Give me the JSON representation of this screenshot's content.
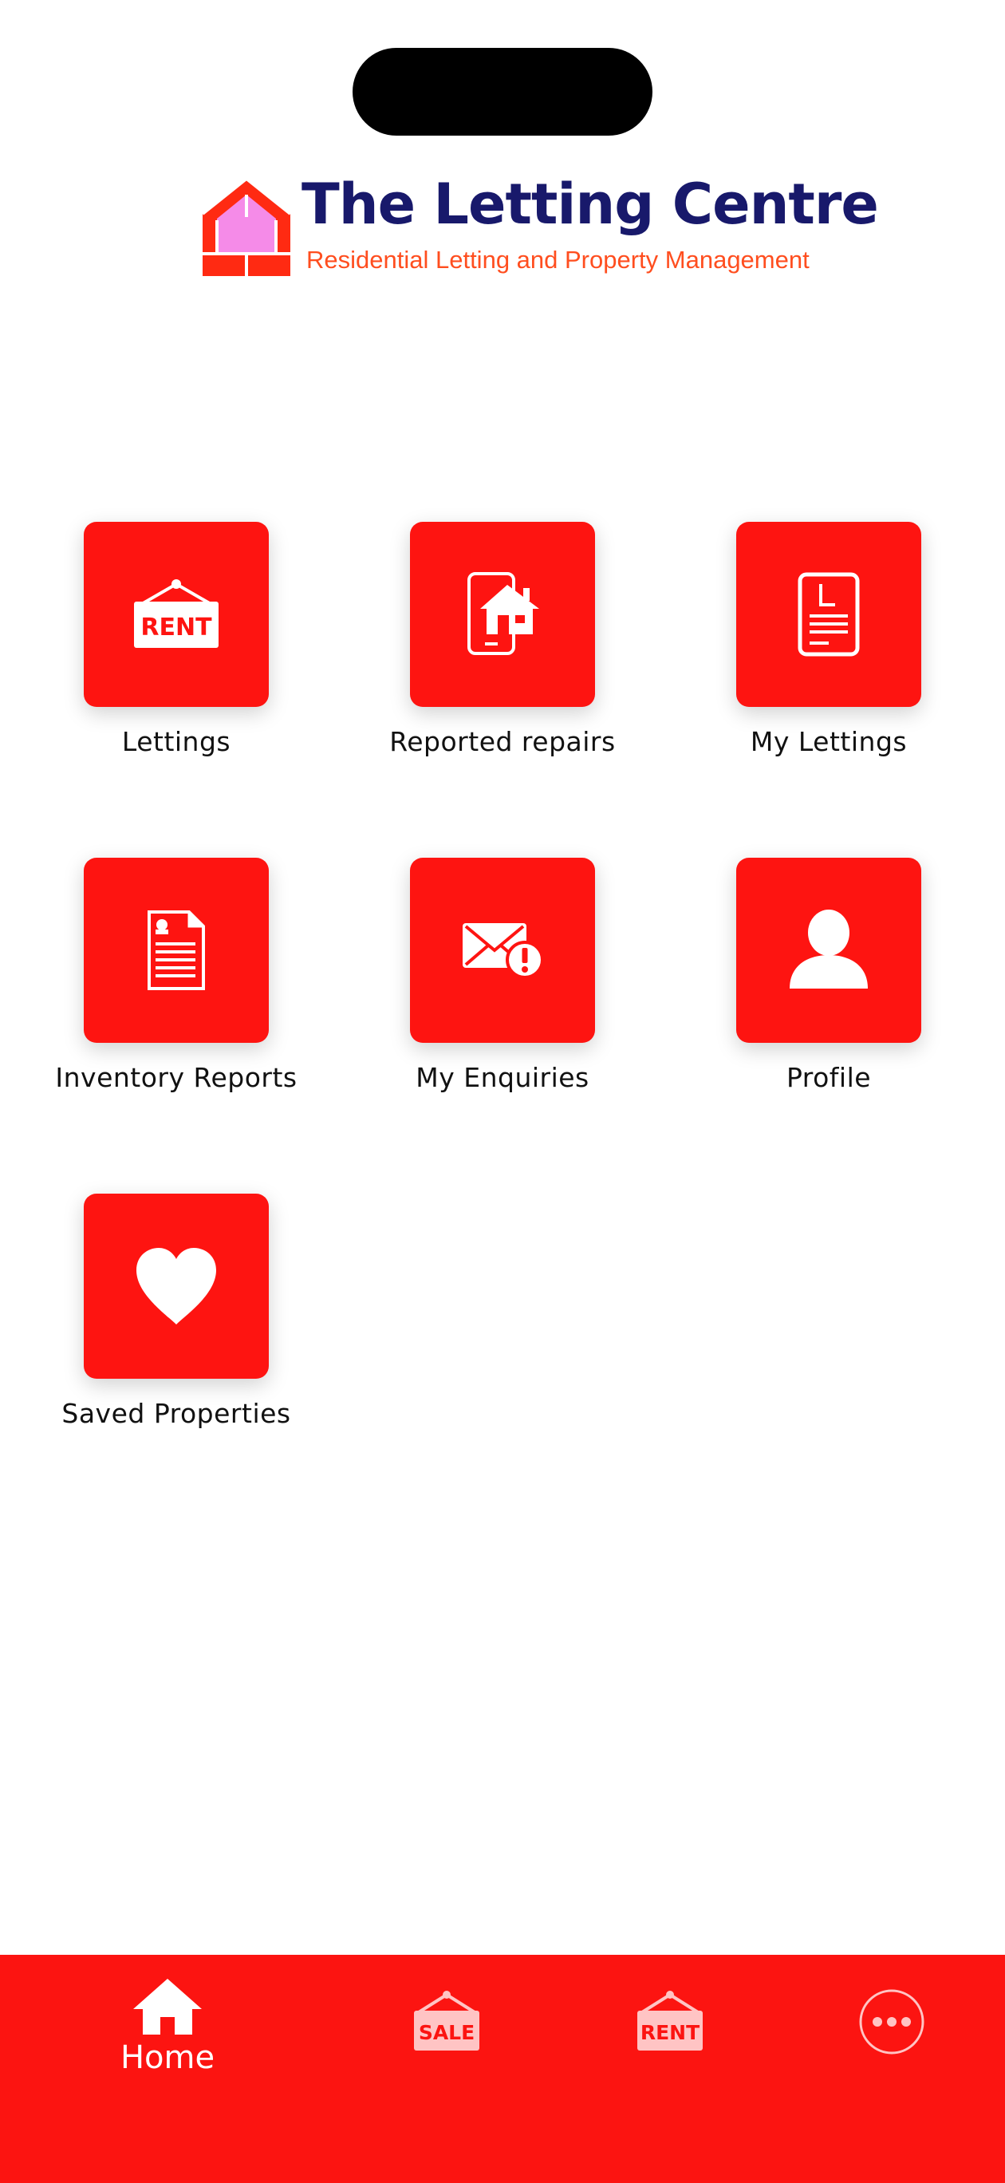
{
  "brand": {
    "title": "The Letting Centre",
    "subtitle": "Residential Letting and Property Management"
  },
  "menu": [
    {
      "label": "Lettings",
      "icon": "rent-sign-icon"
    },
    {
      "label": "Reported repairs",
      "icon": "phone-house-icon"
    },
    {
      "label": "My Lettings",
      "icon": "document-l-icon"
    },
    {
      "label": "Inventory Reports",
      "icon": "report-document-icon"
    },
    {
      "label": "My Enquiries",
      "icon": "envelope-alert-icon"
    },
    {
      "label": "Profile",
      "icon": "user-icon"
    },
    {
      "label": "Saved Properties",
      "icon": "heart-icon"
    }
  ],
  "tabbar": {
    "home": {
      "label": "Home",
      "icon": "home-icon"
    },
    "sale": {
      "sign_text": "SALE",
      "icon": "sale-sign-icon"
    },
    "rent": {
      "sign_text": "RENT",
      "icon": "rent-sign-icon"
    },
    "more": {
      "icon": "more-icon"
    }
  },
  "tile_signs": {
    "rent": "RENT"
  },
  "colors": {
    "accent": "#fe1411",
    "brand_navy": "#18196b",
    "brand_orange": "#ff4e1f"
  }
}
